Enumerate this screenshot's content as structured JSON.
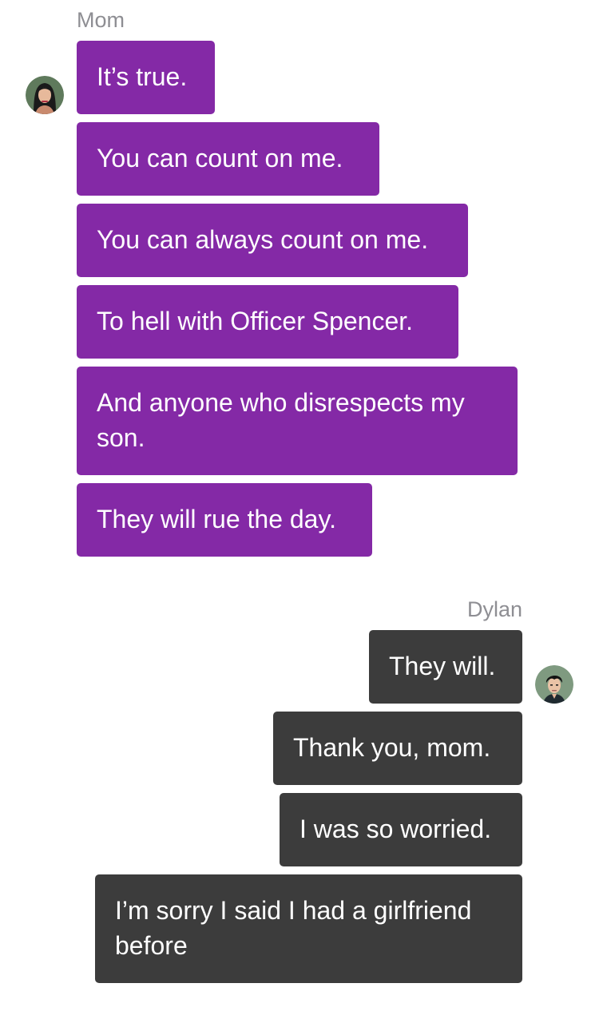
{
  "conversation": {
    "groups": [
      {
        "sender": "Mom",
        "avatar_icon": "mom-portrait-icon",
        "bubble_color": "#8429a6",
        "messages": [
          "It’s true.",
          "You can count on me.",
          "You can always count on me.",
          "To hell with Officer Spencer.",
          "And anyone who disrespects my son.",
          "They will rue the day."
        ]
      },
      {
        "sender": "Dylan",
        "avatar_icon": "dylan-portrait-icon",
        "bubble_color": "#3c3c3c",
        "messages": [
          "They will.",
          "Thank you, mom.",
          "I was so worried.",
          "I’m sorry I said I had a girlfriend before"
        ]
      }
    ]
  }
}
